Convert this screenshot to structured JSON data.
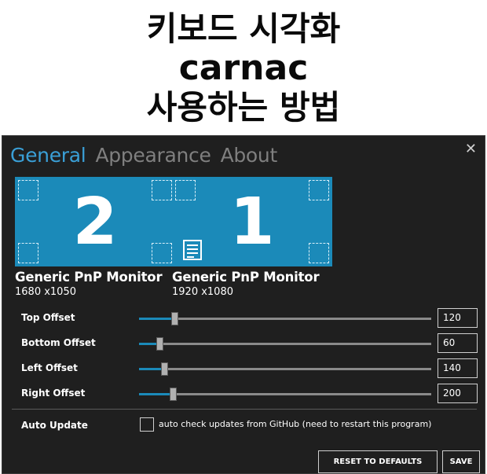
{
  "banner": {
    "line1": "키보드 시각화",
    "line2": "carnac",
    "line3": "사용하는 방법"
  },
  "window": {
    "tabs": [
      {
        "label": "General",
        "active": true
      },
      {
        "label": "Appearance",
        "active": false
      },
      {
        "label": "About",
        "active": false
      }
    ],
    "close_glyph": "✕"
  },
  "monitors": [
    {
      "number": "2",
      "name": "Generic PnP Monitor",
      "resolution": "1680 x1050",
      "has_doc_icon": false
    },
    {
      "number": "1",
      "name": "Generic PnP Monitor",
      "resolution": "1920 x1080",
      "has_doc_icon": true
    }
  ],
  "offsets": [
    {
      "label": "Top Offset",
      "value": "120",
      "fraction": 0.12
    },
    {
      "label": "Bottom Offset",
      "value": "60",
      "fraction": 0.07
    },
    {
      "label": "Left Offset",
      "value": "140",
      "fraction": 0.085
    },
    {
      "label": "Right Offset",
      "value": "200",
      "fraction": 0.115
    }
  ],
  "auto_update": {
    "label": "Auto Update",
    "checkbox_label": "auto check updates from GitHub (need to restart this program)",
    "checked": false
  },
  "buttons": {
    "reset_label": "RESET TO DEFAULTS",
    "save_label": "SAVE"
  },
  "colors": {
    "accent": "#1b8ab9",
    "active_tab": "#3a9fd6",
    "background": "#1f1f1f"
  },
  "icons": {
    "close": "close-icon",
    "doc": "document-icon"
  }
}
